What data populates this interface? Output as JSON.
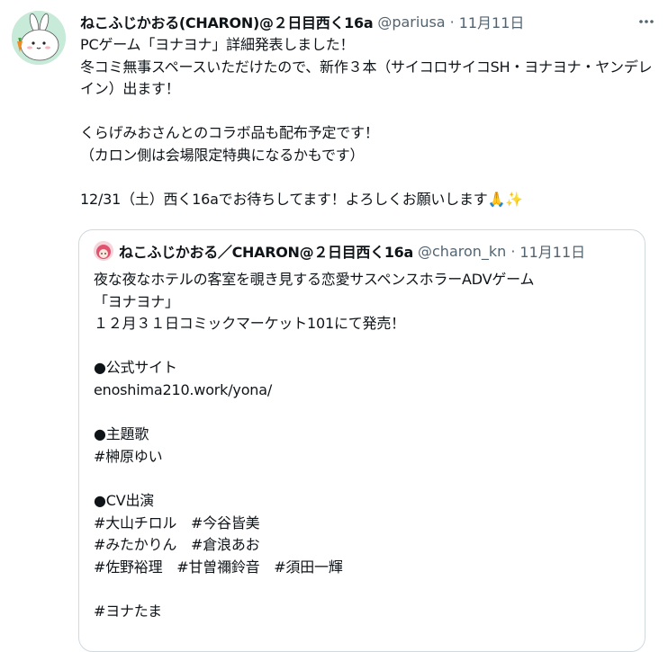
{
  "tweet": {
    "display_name": "ねこふじかおる(CHARON)@２日目西く16a",
    "handle": "@pariusa",
    "separator": "·",
    "date": "11月11日",
    "text": "PCゲーム「ヨナヨナ」詳細発表しました！\n冬コミ無事スペースいただけたので、新作３本（サイコロサイコSH・ヨナヨナ・ヤンデレイン）出ます！\n\nくらげみおさんとのコラボ品も配布予定です！\n（カロン側は会場限定特典になるかもです）\n\n12/31（土）西く16aでお待ちしてます！よろしくお願いします🙏✨"
  },
  "quoted_tweet": {
    "display_name": "ねこふじかおる／CHARON@２日目西く16a",
    "handle": "@charon_kn",
    "separator": "·",
    "date": "11月11日",
    "text": "夜な夜なホテルの客室を覗き見する恋愛サスペンスホラーADVゲーム\n「ヨナヨナ」\n１２月３１日コミックマーケット101にて発売！\n\n●公式サイト\nenoshima210.work/yona/\n\n●主題歌\n#榊原ゆい\n\n●CV出演\n#大山チロル　#今谷皆美\n#みたかりん　#倉浪あお\n#佐野裕理　#甘曽禰鈴音　#須田一輝\n\n#ヨナたま"
  },
  "icons": {
    "more": "more-horizontal-icon",
    "avatar": "rabbit-mascot-avatar",
    "quoted_avatar": "pink-hair-character-avatar"
  },
  "colors": {
    "text": "#0f1419",
    "muted": "#536471",
    "border": "#cfd9de"
  }
}
